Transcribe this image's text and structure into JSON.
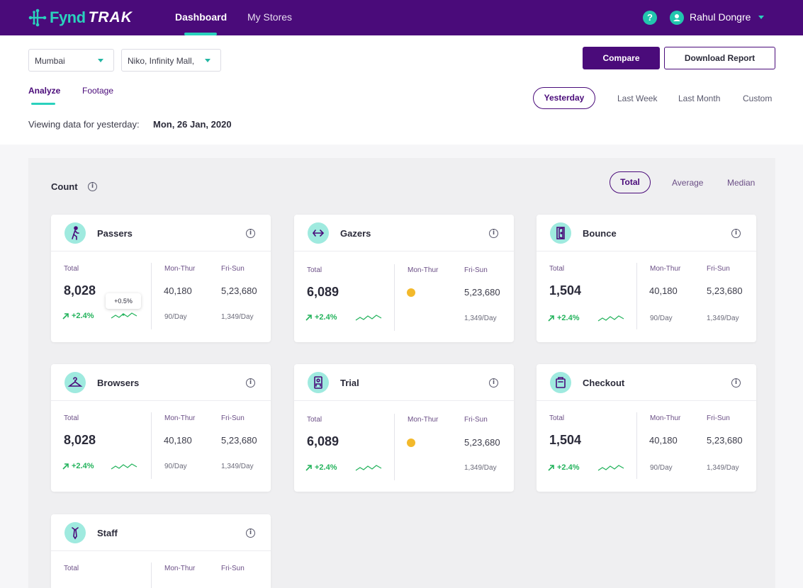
{
  "brand": {
    "name_part1": "Fynd",
    "name_part2": "TRAK"
  },
  "nav": {
    "dashboard": "Dashboard",
    "my_stores": "My Stores",
    "help": "?",
    "user_name": "Rahul Dongre"
  },
  "filters": {
    "city": "Mumbai",
    "store": "Niko, Infinity Mall,"
  },
  "actions": {
    "compare": "Compare",
    "download": "Download Report"
  },
  "tabs": {
    "analyze": "Analyze",
    "footage": "Footage"
  },
  "ranges": {
    "yesterday": "Yesterday",
    "last_week": "Last Week",
    "last_month": "Last Month",
    "custom": "Custom"
  },
  "viewing": {
    "label": "Viewing data for yesterday:",
    "date": "Mon, 26 Jan, 2020"
  },
  "count": {
    "title": "Count",
    "total": "Total",
    "average": "Average",
    "median": "Median"
  },
  "colors": {
    "primary": "#4a0b7a",
    "accent": "#2ad1bd",
    "positive": "#23b35c",
    "warning": "#f3b92b"
  },
  "cards": [
    {
      "title": "Passers",
      "icon": "walking-person-icon",
      "total_label": "Total",
      "total": "8,028",
      "trend": "+2.4%",
      "tooltip": "+0.5%",
      "mon_label": "Mon-Thur",
      "mon_value": "40,180",
      "mon_per_day": "90/Day",
      "fri_label": "Fri-Sun",
      "fri_value": "5,23,680",
      "fri_per_day": "1,349/Day"
    },
    {
      "title": "Gazers",
      "icon": "eye-gaze-icon",
      "total_label": "Total",
      "total": "6,089",
      "trend": "+2.4%",
      "mon_label": "Mon-Thur",
      "mon_value": "",
      "mon_per_day": "",
      "fri_label": "Fri-Sun",
      "fri_value": "5,23,680",
      "fri_per_day": "1,349/Day"
    },
    {
      "title": "Bounce",
      "icon": "door-exit-icon",
      "total_label": "Total",
      "total": "1,504",
      "trend": "+2.4%",
      "mon_label": "Mon-Thur",
      "mon_value": "40,180",
      "mon_per_day": "90/Day",
      "fri_label": "Fri-Sun",
      "fri_value": "5,23,680",
      "fri_per_day": "1,349/Day"
    },
    {
      "title": "Browsers",
      "icon": "hanger-icon",
      "total_label": "Total",
      "total": "8,028",
      "trend": "+2.4%",
      "mon_label": "Mon-Thur",
      "mon_value": "40,180",
      "mon_per_day": "90/Day",
      "fri_label": "Fri-Sun",
      "fri_value": "5,23,680",
      "fri_per_day": "1,349/Day"
    },
    {
      "title": "Trial",
      "icon": "trial-room-icon",
      "total_label": "Total",
      "total": "6,089",
      "trend": "+2.4%",
      "mon_label": "Mon-Thur",
      "mon_value": "",
      "mon_per_day": "",
      "fri_label": "Fri-Sun",
      "fri_value": "5,23,680",
      "fri_per_day": "1,349/Day"
    },
    {
      "title": "Checkout",
      "icon": "shopping-bag-icon",
      "total_label": "Total",
      "total": "1,504",
      "trend": "+2.4%",
      "mon_label": "Mon-Thur",
      "mon_value": "40,180",
      "mon_per_day": "90/Day",
      "fri_label": "Fri-Sun",
      "fri_value": "5,23,680",
      "fri_per_day": "1,349/Day"
    },
    {
      "title": "Staff",
      "icon": "staff-tie-icon",
      "total_label": "Total",
      "mon_label": "Mon-Thur",
      "fri_label": "Fri-Sun"
    }
  ]
}
